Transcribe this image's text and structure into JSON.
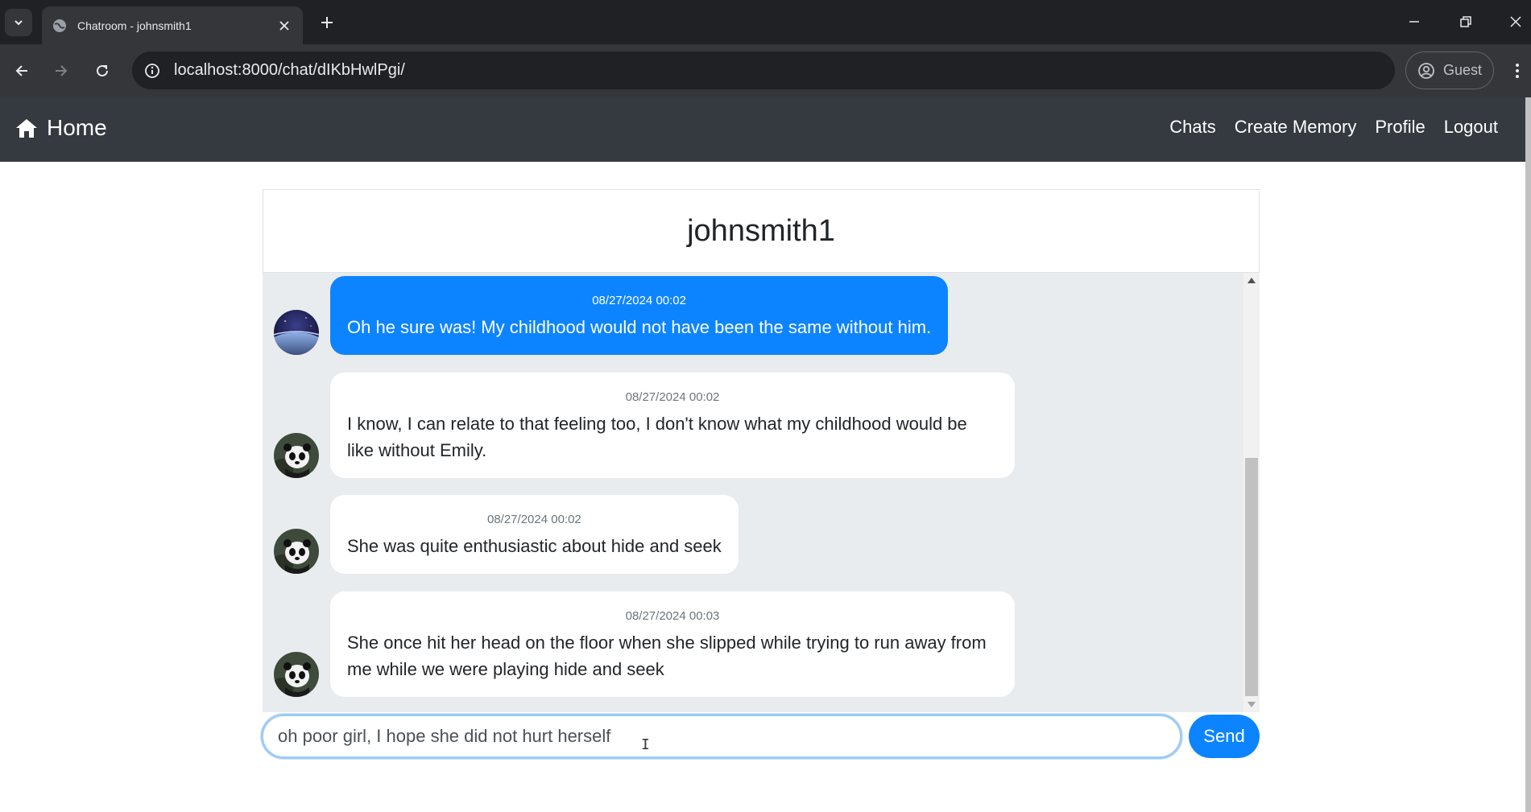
{
  "browser": {
    "tab_title": "Chatroom - johnsmith1",
    "url": "localhost:8000/chat/dIKbHwlPgi/",
    "profile_label": "Guest"
  },
  "navbar": {
    "brand": "Home",
    "links": [
      "Chats",
      "Create Memory",
      "Profile",
      "Logout"
    ]
  },
  "chat": {
    "title": "johnsmith1",
    "messages": [
      {
        "timestamp": "08/27/2024 00:02",
        "text": "Oh he sure was! My childhood would not have been the same without him.",
        "kind": "sent"
      },
      {
        "timestamp": "08/27/2024 00:02",
        "text": "I know, I can relate to that feeling too, I don't know what my childhood would be like without Emily.",
        "kind": "received"
      },
      {
        "timestamp": "08/27/2024 00:02",
        "text": "She was quite enthusiastic about hide and seek",
        "kind": "received"
      },
      {
        "timestamp": "08/27/2024 00:03",
        "text": "She once hit her head on the floor when she slipped while trying to run away from me while we were playing hide and seek",
        "kind": "received"
      }
    ],
    "input_value": "oh poor girl, I hope she did not hurt herself",
    "send_label": "Send"
  },
  "colors": {
    "accent": "#0d84ff",
    "navbar": "#343a40",
    "messages_bg": "#e9ecef"
  },
  "icons": {
    "brand": "home-icon",
    "avatar_sent": "space-planet-avatar",
    "avatar_received": "panda-avatar"
  }
}
